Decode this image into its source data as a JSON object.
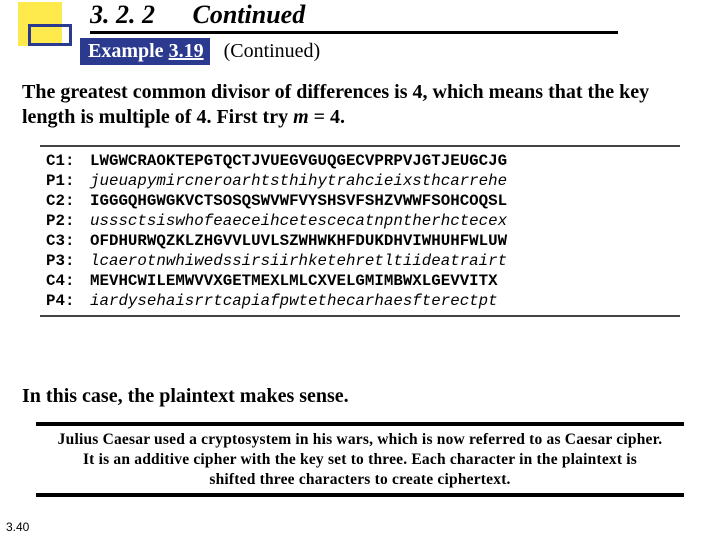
{
  "section": {
    "number": "3. 2. 2",
    "title": "Continued"
  },
  "example": {
    "label_pre": "Example",
    "label_num": "3.19",
    "status": "(Continued)"
  },
  "intro": "The greatest common divisor of differences is 4, which means that the key length is multiple of 4. First try ",
  "intro_m": "m",
  "intro_tail": " = 4.",
  "rows": [
    {
      "label": "C1:",
      "value": "LWGWCRAOKTEPGTQCTJVUEGVGUQGECVPRPVJGTJEUGCJG",
      "style": "bold"
    },
    {
      "label": "P1:",
      "value": "jueuapymircneroarhtsthihytrahcieixsthcarrehe",
      "style": "ital"
    },
    {
      "label": "C2:",
      "value": "IGGGQHGWGKVCTSOSQSWVWFVYSHSVFSHZVWWFSOHCOQSL",
      "style": "bold"
    },
    {
      "label": "P2:",
      "value": "usssctsiswhofeaeceihcetescecatnpntherhctecex",
      "style": "ital"
    },
    {
      "label": "C3:",
      "value": "OFDHURWQZKLZHGVVLUVLSZWHWKHFDUKDHVIWHUHFWLUW",
      "style": "bold"
    },
    {
      "label": "P3:",
      "value": "lcaerotnwhiwedssirsiirhketehretltiideatrairt",
      "style": "ital"
    },
    {
      "label": "C4:",
      "value": "MEVHCWILEMWVVXGETMEXLMLCXVELGMIMBWXLGEVVITX",
      "style": "bold"
    },
    {
      "label": "P4:",
      "value": "iardysehaisrrtcapiafpwtethecarhaesfterectpt",
      "style": "ital"
    }
  ],
  "conclusion": "In this case, the plaintext makes sense.",
  "quote_lines": [
    "Julius Caesar used a cryptosystem in his wars, which is now referred to as Caesar cipher.",
    "It is an additive cipher with the key set to three. Each character in the plaintext is",
    "shifted three characters to create ciphertext."
  ],
  "page_number": "3.40"
}
